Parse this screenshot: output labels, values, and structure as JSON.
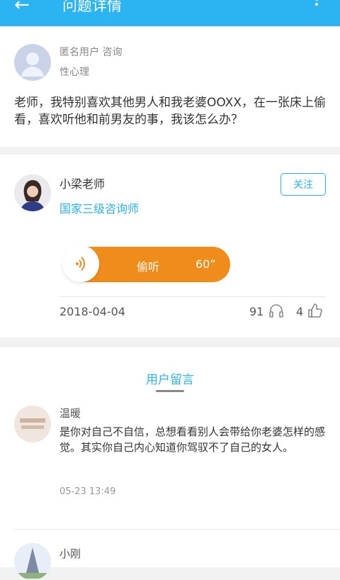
{
  "header": {
    "back_icon": "←",
    "title": "问题详情"
  },
  "question": {
    "user": "匿名用户 咨询",
    "category": "性心理",
    "text": "老师，我特别喜欢其他男人和我老婆OOXX，在一张床上偷看，喜欢听他和前男友的事，我该怎么办？"
  },
  "answer": {
    "teacher_name": "小梁老师",
    "teacher_title": "国家三级咨询师",
    "follow_label": "关注",
    "listen_label": "偷听",
    "duration": "60”",
    "date": "2018-04-04",
    "listens": "91",
    "likes": "4"
  },
  "comments": {
    "title": "用户留言",
    "items": [
      {
        "name": "温暖",
        "text": "是你对自己不自信，总想看看别人会带给你老婆怎样的感觉。其实你自己内心知道你驾驭不了自己的女人。",
        "time": "05-23 13:49"
      },
      {
        "name": "小刚"
      }
    ]
  }
}
